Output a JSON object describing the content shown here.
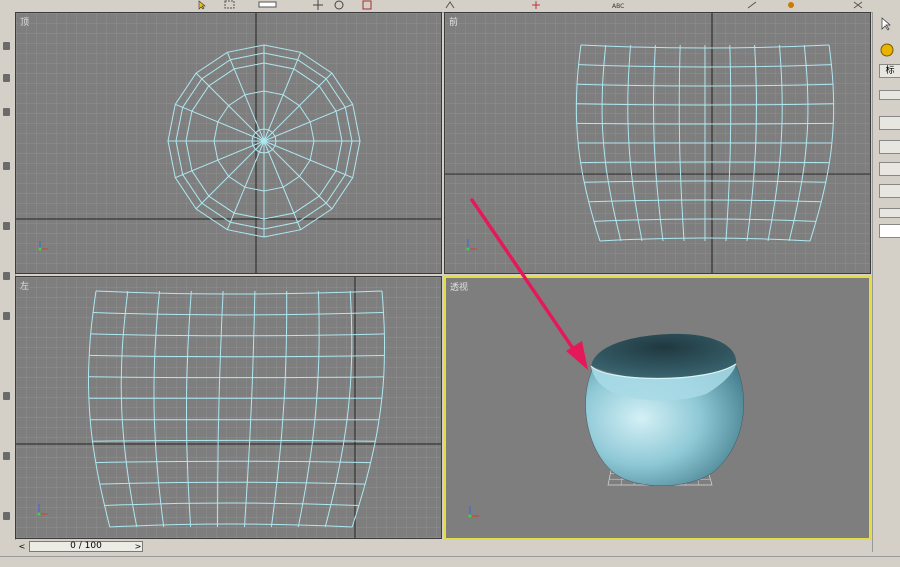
{
  "viewports": {
    "top": {
      "label": "顶"
    },
    "front": {
      "label": "前"
    },
    "left": {
      "label": "左"
    },
    "perspective": {
      "label": "透视"
    }
  },
  "timeline": {
    "value": "0 / 100",
    "prev": "<",
    "next": ">"
  },
  "command_panel": {
    "tab_label": "标"
  },
  "colors": {
    "viewport_bg": "#7e7e7e",
    "grid_line": "#9a9a9a",
    "wireframe": "#aee8f2",
    "active_border": "#e4dc47",
    "arrow": "#e5195a",
    "object_fill": "#8fc9d6"
  },
  "icons": [
    "select-arrow-icon",
    "move-icon",
    "rotate-icon",
    "axis-tripod-icon"
  ]
}
